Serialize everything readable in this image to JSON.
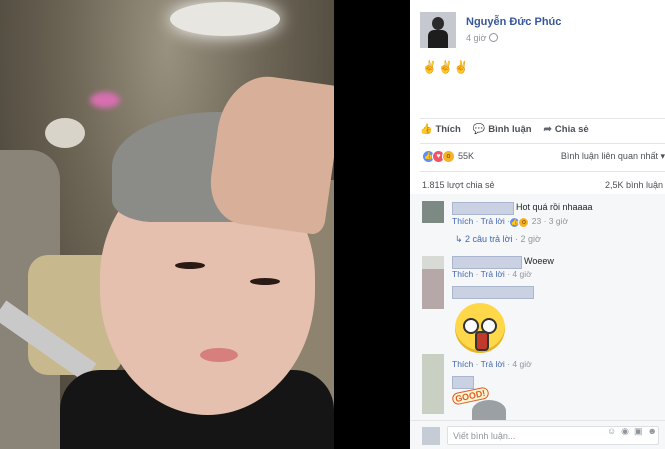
{
  "post": {
    "author": "Nguyễn Đức Phúc",
    "time": "4 giờ",
    "status": "✌✌✌"
  },
  "actions": {
    "like": "Thích",
    "comment": "Bình luận",
    "share": "Chia sẻ"
  },
  "reactions": {
    "count": "55K",
    "sort": "Bình luận liên quan nhất ▾"
  },
  "stats": {
    "shares": "1.815 lượt chia sẻ",
    "comments": "2,5K bình luận"
  },
  "comments": [
    {
      "text": "Hot quá rồi nhaaaa",
      "like": "Thích",
      "reply": "Trả lời",
      "reactions": "23",
      "time": "3 giờ",
      "replies_link": "2 câu trả lời",
      "replies_time": "2 giờ"
    },
    {
      "text": "Woeew",
      "like": "Thích",
      "reply": "Trả lời",
      "time": "4 giờ"
    },
    {
      "like": "Thích",
      "reply": "Trả lời",
      "time": "4 giờ",
      "sticker_text": "GOOD!"
    }
  ],
  "input": {
    "placeholder": "Viết bình luận..."
  },
  "colors": {
    "link": "#365899",
    "accent": "#4267b2"
  }
}
